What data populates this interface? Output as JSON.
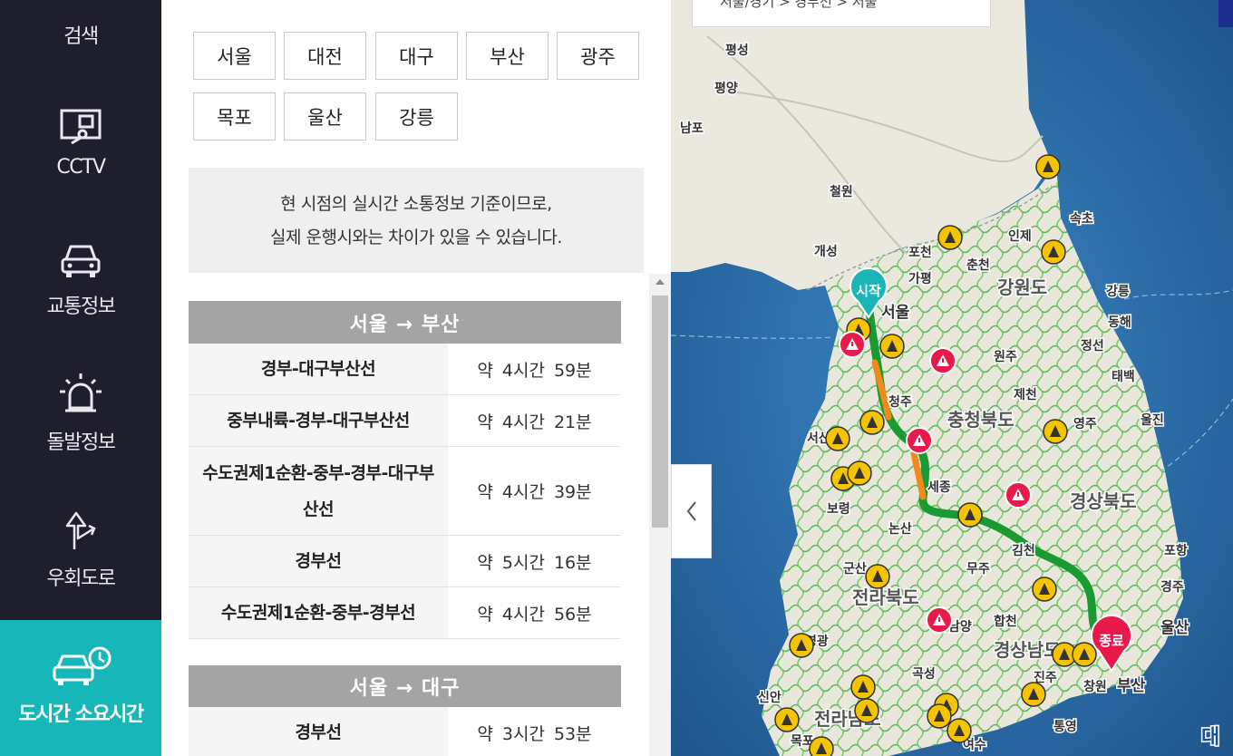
{
  "nav": {
    "items": [
      {
        "label": "검색",
        "icon": "search-icon"
      },
      {
        "label": "CCTV",
        "icon": "cctv-icon"
      },
      {
        "label": "교통정보",
        "icon": "car-icon"
      },
      {
        "label": "돌발정보",
        "icon": "siren-icon"
      },
      {
        "label": "우회도로",
        "icon": "detour-icon"
      },
      {
        "label": "도시간 소요시간",
        "icon": "car-clock-icon",
        "active": true
      }
    ]
  },
  "cities": [
    "서울",
    "대전",
    "대구",
    "부산",
    "광주",
    "목포",
    "울산",
    "강릉"
  ],
  "notice": {
    "line1": "현 시점의 실시간 소통정보 기준이므로,",
    "line2": "실제 운행시와는 차이가 있을 수 있습니다."
  },
  "routes": [
    {
      "title": "서울 → 부산",
      "rows": [
        {
          "name": "경부-대구부산선",
          "time": "약 4시간 59분"
        },
        {
          "name": "중부내륙-경부-대구부산선",
          "time": "약 4시간 21분"
        },
        {
          "name": "수도권제1순환-중부-경부-대구부산선",
          "time": "약 4시간 39분"
        },
        {
          "name": "경부선",
          "time": "약 5시간 16분"
        },
        {
          "name": "수도권제1순환-중부-경부선",
          "time": "약 4시간 56분"
        }
      ]
    },
    {
      "title": "서울 → 대구",
      "rows": [
        {
          "name": "경부선",
          "time": "약 3시간 53분"
        }
      ]
    }
  ],
  "map": {
    "breadcrumb": "서울/경기 > 경부선 > 서울",
    "start_label": "시작",
    "end_label": "종료",
    "place_labels": [
      "평성",
      "평양",
      "남포",
      "철원",
      "개성",
      "포천",
      "가평",
      "춘천",
      "인제",
      "속초",
      "강릉",
      "동해",
      "서울",
      "강원도",
      "원주",
      "정선",
      "태백",
      "제천",
      "충청북도",
      "영주",
      "울진",
      "세종",
      "보령",
      "논산",
      "경상북도",
      "김천",
      "포항",
      "군산",
      "무주",
      "전라북도",
      "경주",
      "울산",
      "합천",
      "경상남도",
      "부산",
      "창원",
      "진주",
      "통영",
      "목포",
      "전라남도",
      "신안",
      "영광",
      "곡성",
      "여수",
      "남양",
      "서산",
      "대",
      "청주"
    ],
    "colors": {
      "land": "#e9e7dc",
      "sea": "#2b6aa6",
      "route": "#1bb23a",
      "start": "#1ab5b6",
      "end": "#e8194b",
      "warn": "#f5c400"
    }
  }
}
